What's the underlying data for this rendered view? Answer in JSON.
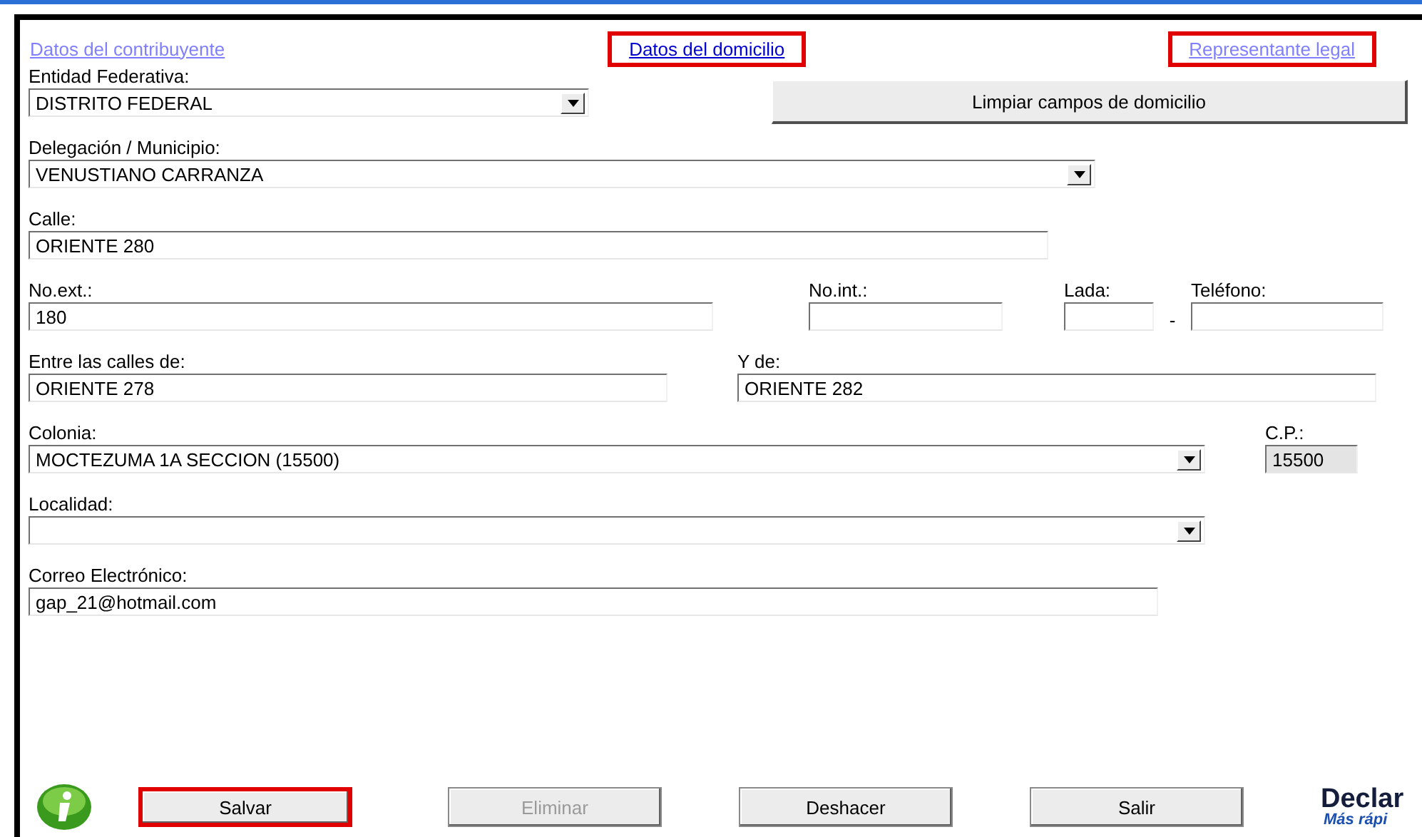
{
  "tabs": [
    {
      "label": "Datos del contribuyente",
      "selected": false,
      "highlighted": false
    },
    {
      "label": "Datos del domicilio",
      "selected": true,
      "highlighted": true
    },
    {
      "label": "Representante legal",
      "selected": false,
      "highlighted": true
    }
  ],
  "clear_button": {
    "label": "Limpiar campos de domicilio"
  },
  "fields": [
    {
      "label": "Entidad Federativa:",
      "value": "DISTRITO FEDERAL",
      "kind": "select"
    },
    {
      "label": "Delegación / Municipio:",
      "value": "VENUSTIANO CARRANZA",
      "kind": "select"
    },
    {
      "label": "Calle:",
      "value": "ORIENTE 280",
      "kind": "text"
    },
    {
      "label": "No.ext.:",
      "value": "180",
      "kind": "text"
    },
    {
      "label": "No.int.:",
      "kind": "text"
    },
    {
      "label": "Lada:",
      "kind": "text"
    },
    {
      "label": "Teléfono:",
      "kind": "text"
    },
    {
      "label": "Entre las calles de:",
      "value": "ORIENTE 278",
      "kind": "text"
    },
    {
      "label": "Y de:",
      "value": "ORIENTE 282",
      "kind": "text"
    },
    {
      "label": "Colonia:",
      "value": "MOCTEZUMA 1A SECCION (15500)",
      "kind": "select"
    },
    {
      "label": "C.P.:",
      "value": "15500",
      "kind": "readonly"
    },
    {
      "label": "Localidad:",
      "kind": "select"
    },
    {
      "label": "Correo Electrónico:",
      "value": "gap_21@hotmail.com",
      "kind": "text"
    }
  ],
  "phone_separator": "-",
  "buttons": [
    {
      "label": "Salvar",
      "disabled": false,
      "highlighted": true
    },
    {
      "label": "Eliminar",
      "disabled": true,
      "highlighted": false
    },
    {
      "label": "Deshacer",
      "disabled": false,
      "highlighted": false
    },
    {
      "label": "Salir",
      "disabled": false,
      "highlighted": false
    }
  ],
  "logo": {
    "title": "Declar",
    "subtitle": "Más rápi"
  }
}
